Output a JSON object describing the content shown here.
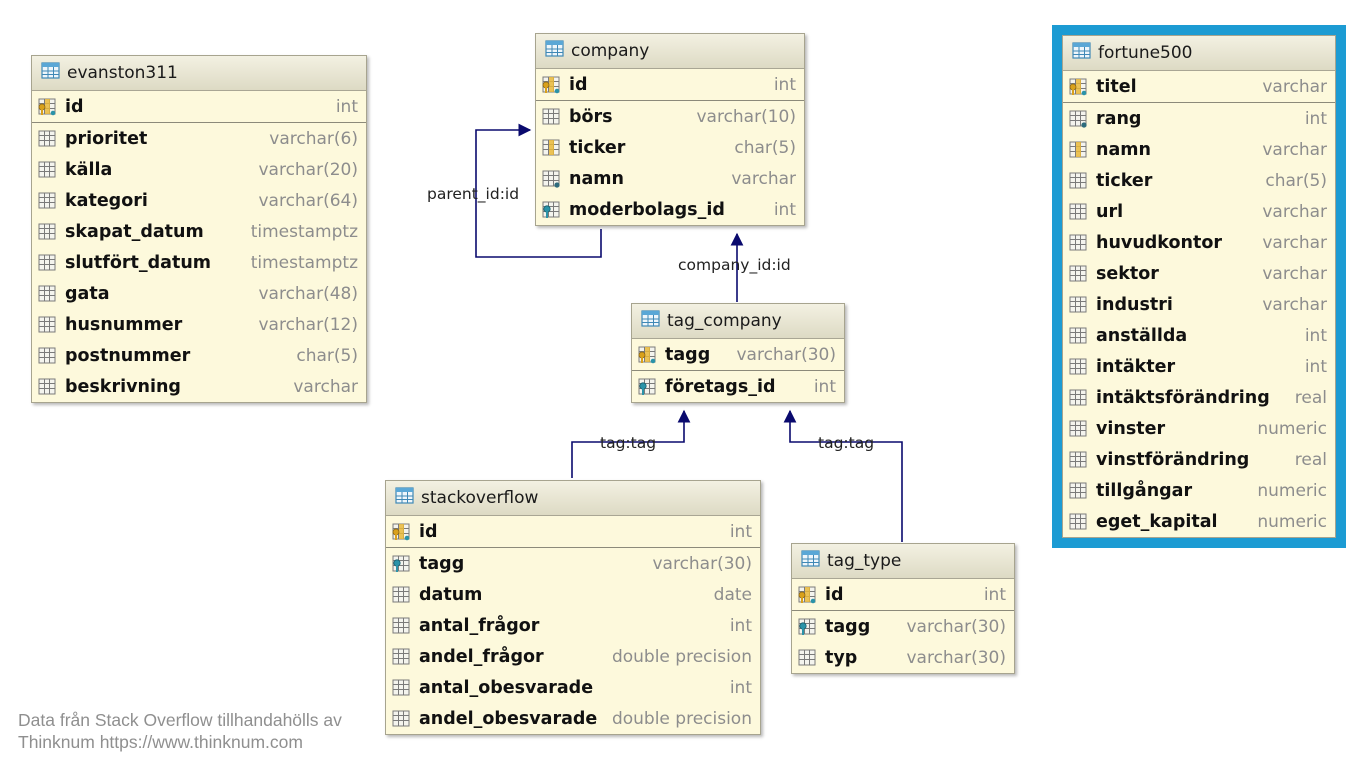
{
  "tables": [
    {
      "id": "evanston311",
      "title": "evanston311",
      "columns": [
        {
          "name": "id",
          "type": "int",
          "icon": "primary-key"
        },
        {
          "name": "prioritet",
          "type": "varchar(6)",
          "icon": "column"
        },
        {
          "name": "källa",
          "type": "varchar(20)",
          "icon": "column"
        },
        {
          "name": "kategori",
          "type": "varchar(64)",
          "icon": "column"
        },
        {
          "name": "skapat_datum",
          "type": "timestamptz",
          "icon": "column"
        },
        {
          "name": "slutfört_datum",
          "type": "timestamptz",
          "icon": "column"
        },
        {
          "name": "gata",
          "type": "varchar(48)",
          "icon": "column"
        },
        {
          "name": "husnummer",
          "type": "varchar(12)",
          "icon": "column"
        },
        {
          "name": "postnummer",
          "type": "char(5)",
          "icon": "column"
        },
        {
          "name": "beskrivning",
          "type": "varchar",
          "icon": "column"
        }
      ]
    },
    {
      "id": "company",
      "title": "company",
      "columns": [
        {
          "name": "id",
          "type": "int",
          "icon": "primary-key"
        },
        {
          "name": "börs",
          "type": "varchar(10)",
          "icon": "column"
        },
        {
          "name": "ticker",
          "type": "char(5)",
          "icon": "unique-column"
        },
        {
          "name": "namn",
          "type": "varchar",
          "icon": "not-null-column"
        },
        {
          "name": "moderbolags_id",
          "type": "int",
          "icon": "foreign-key"
        }
      ]
    },
    {
      "id": "tag_company",
      "title": "tag_company",
      "columns": [
        {
          "name": "tagg",
          "type": "varchar(30)",
          "icon": "primary-key"
        },
        {
          "name": "företags_id",
          "type": "int",
          "icon": "foreign-key"
        }
      ]
    },
    {
      "id": "stackoverflow",
      "title": "stackoverflow",
      "columns": [
        {
          "name": "id",
          "type": "int",
          "icon": "primary-key"
        },
        {
          "name": "tagg",
          "type": "varchar(30)",
          "icon": "foreign-key"
        },
        {
          "name": "datum",
          "type": "date",
          "icon": "column"
        },
        {
          "name": "antal_frågor",
          "type": "int",
          "icon": "column"
        },
        {
          "name": "andel_frågor",
          "type": "double precision",
          "icon": "column"
        },
        {
          "name": "antal_obesvarade",
          "type": "int",
          "icon": "column"
        },
        {
          "name": "andel_obesvarade",
          "type": "double precision",
          "icon": "column"
        }
      ]
    },
    {
      "id": "tag_type",
      "title": "tag_type",
      "columns": [
        {
          "name": "id",
          "type": "int",
          "icon": "primary-key"
        },
        {
          "name": "tagg",
          "type": "varchar(30)",
          "icon": "foreign-key"
        },
        {
          "name": "typ",
          "type": "varchar(30)",
          "icon": "column"
        }
      ]
    },
    {
      "id": "fortune500",
      "title": "fortune500",
      "highlighted": true,
      "columns": [
        {
          "name": "titel",
          "type": "varchar",
          "icon": "primary-key"
        },
        {
          "name": "rang",
          "type": "int",
          "icon": "not-null-column"
        },
        {
          "name": "namn",
          "type": "varchar",
          "icon": "unique-column"
        },
        {
          "name": "ticker",
          "type": "char(5)",
          "icon": "column"
        },
        {
          "name": "url",
          "type": "varchar",
          "icon": "column"
        },
        {
          "name": "huvudkontor",
          "type": "varchar",
          "icon": "column"
        },
        {
          "name": "sektor",
          "type": "varchar",
          "icon": "column"
        },
        {
          "name": "industri",
          "type": "varchar",
          "icon": "column"
        },
        {
          "name": "anställda",
          "type": "int",
          "icon": "column"
        },
        {
          "name": "intäkter",
          "type": "int",
          "icon": "column"
        },
        {
          "name": "intäktsförändring",
          "type": "real",
          "icon": "column"
        },
        {
          "name": "vinster",
          "type": "numeric",
          "icon": "column"
        },
        {
          "name": "vinstförändring",
          "type": "real",
          "icon": "column"
        },
        {
          "name": "tillgångar",
          "type": "numeric",
          "icon": "column"
        },
        {
          "name": "eget_kapital",
          "type": "numeric",
          "icon": "column"
        }
      ]
    }
  ],
  "relations": [
    {
      "id": "parent",
      "label": "parent_id:id",
      "from": "company",
      "to": "company"
    },
    {
      "id": "company_id",
      "label": "company_id:id",
      "from": "tag_company",
      "to": "company"
    },
    {
      "id": "tag_so",
      "label": "tag:tag",
      "from": "stackoverflow",
      "to": "tag_company"
    },
    {
      "id": "tag_tt",
      "label": "tag:tag",
      "from": "tag_type",
      "to": "tag_company"
    }
  ],
  "colors": {
    "table_background": "#fdf9dc",
    "relation_line": "#0a0a6e",
    "highlight_border": "#1c9bd3",
    "key_icon_gold": "#d9a11c",
    "key_icon_teal": "#2b93a8"
  },
  "footnote": {
    "line1": "Data från Stack Overflow tillhandahölls av",
    "line2": "Thinknum https://www.thinknum.com"
  }
}
